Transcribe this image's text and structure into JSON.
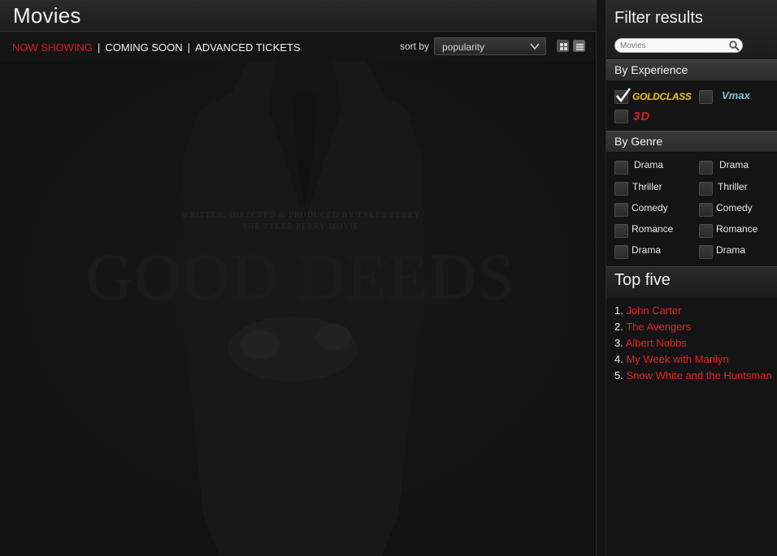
{
  "main": {
    "title": "Movies",
    "nav": [
      {
        "label": "NOW SHOWING",
        "active": true
      },
      {
        "label": "COMING SOON",
        "active": false
      },
      {
        "label": "ADVANCED TICKETS",
        "active": false
      }
    ],
    "sort_label": "sort by",
    "sort_value": "popularity",
    "poster": {
      "tagline_1": "WRITTEN, DIRECTED & PRODUCED BY TYLER PERRY",
      "tagline_2": "THE TYLER PERRY MOVIE",
      "title": "GOOD DEEDS"
    }
  },
  "sidebar": {
    "filter_title": "Filter results",
    "search_placeholder": "Movies",
    "experience_heading": "By Experience",
    "experiences": [
      {
        "label": "GOLDCLASS",
        "checked": true
      },
      {
        "label": "Vmax",
        "checked": false
      },
      {
        "label": "3D",
        "checked": false
      }
    ],
    "genre_heading": "By Genre",
    "genres_left": [
      "Drama",
      "Thriller",
      "Comedy",
      "Romance",
      "Drama"
    ],
    "genres_right": [
      "Drama",
      "Thriller",
      "Comedy",
      "Romance",
      "Drama"
    ],
    "top_title": "Top five",
    "top_five": [
      {
        "num": "1.",
        "title": "John Carter"
      },
      {
        "num": "2.",
        "title": "The Avengers"
      },
      {
        "num": "3.",
        "title": "Albert Nobbs"
      },
      {
        "num": "4.",
        "title": "My Week with Marilyn"
      },
      {
        "num": "5.",
        "title": "Snow White and the Huntsman"
      }
    ]
  },
  "colors": {
    "accent_red": "#e0181a",
    "gold": "#e0b43a",
    "vmax": "#7fc0df"
  }
}
